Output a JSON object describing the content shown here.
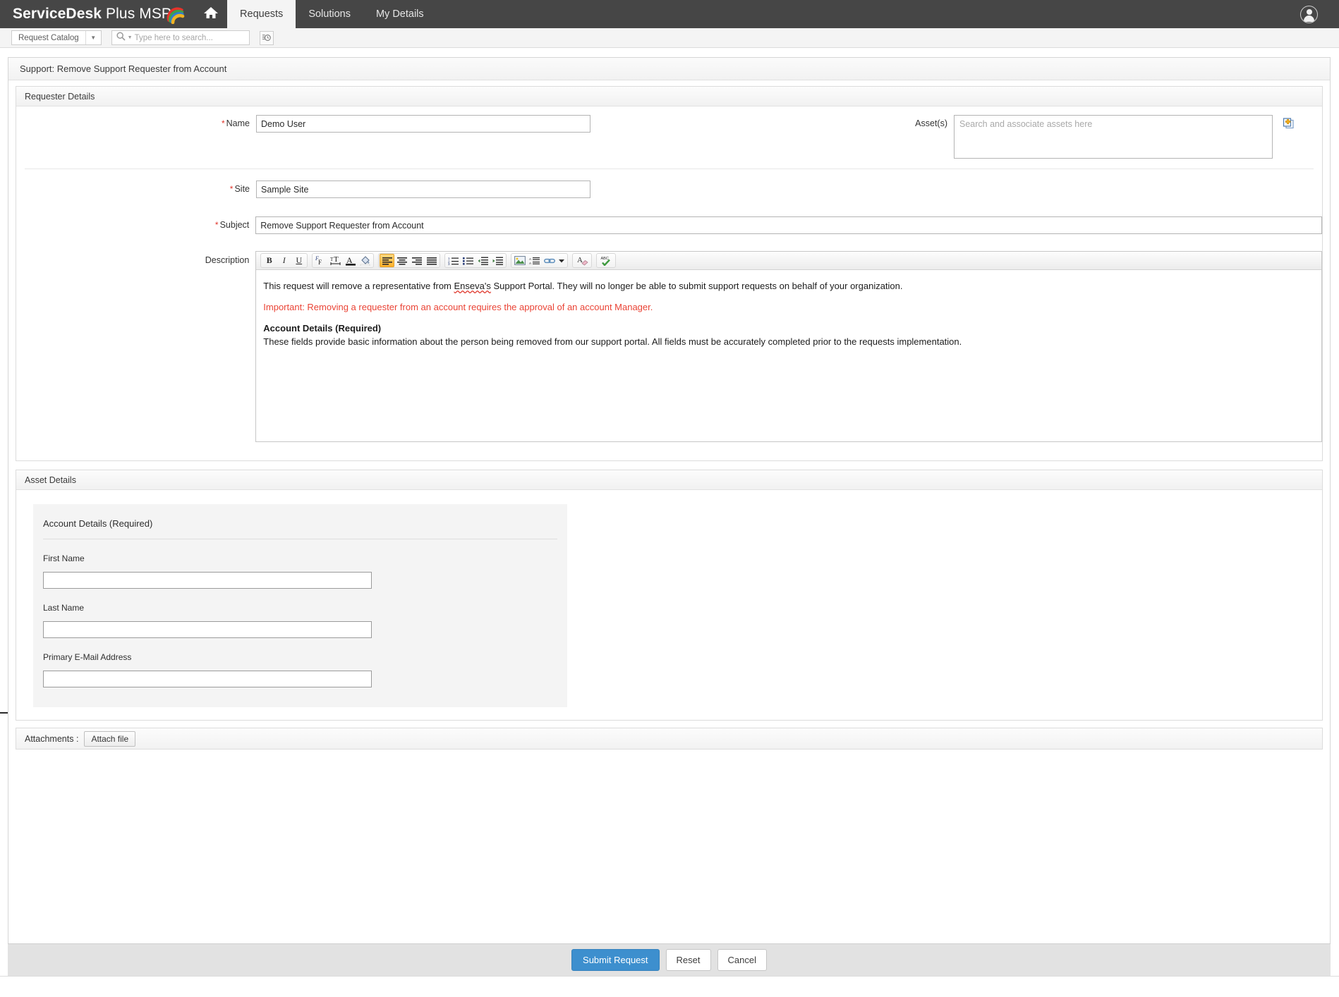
{
  "header": {
    "brand_bold": "ServiceDesk",
    "brand_rest": "Plus MSP",
    "home_icon": "home-icon",
    "tabs": [
      {
        "label": "Requests",
        "active": true
      },
      {
        "label": "Solutions",
        "active": false
      },
      {
        "label": "My Details",
        "active": false
      }
    ],
    "user_icon": "user-avatar-icon"
  },
  "searchbar": {
    "catalog_label": "Request Catalog",
    "catalog_caret_icon": "chevron-down-icon",
    "search_icon": "search-icon",
    "search_caret_icon": "chevron-down-icon",
    "search_placeholder": "Type here to search...",
    "search_value": "",
    "history_icon": "search-history-icon"
  },
  "page": {
    "title": "Support: Remove Support Requester from Account"
  },
  "requester_section": {
    "heading": "Requester Details",
    "name": {
      "label": "Name",
      "required": true,
      "value": "Demo User"
    },
    "assets": {
      "label": "Asset(s)",
      "placeholder": "Search and associate assets here",
      "value": "",
      "add_icon": "add-asset-icon"
    },
    "site": {
      "label": "Site",
      "required": true,
      "value": "Sample Site"
    },
    "subject": {
      "label": "Subject",
      "required": true,
      "value": "Remove Support Requester from Account"
    },
    "description": {
      "label": "Description",
      "toolbar": [
        {
          "name": "bold-icon",
          "glyph": "B",
          "active": false
        },
        {
          "name": "italic-icon",
          "glyph": "I",
          "active": false
        },
        {
          "name": "underline-icon",
          "glyph": "U",
          "active": false
        },
        {
          "name": "font-family-icon",
          "glyph": "F",
          "active": false
        },
        {
          "name": "font-size-icon",
          "glyph": "T",
          "active": false
        },
        {
          "name": "text-color-icon",
          "glyph": "A",
          "active": false
        },
        {
          "name": "background-color-icon",
          "glyph": "paint",
          "active": false
        },
        {
          "name": "align-left-icon",
          "glyph": "lines",
          "active": true
        },
        {
          "name": "align-center-icon",
          "glyph": "lines",
          "active": false
        },
        {
          "name": "align-right-icon",
          "glyph": "lines",
          "active": false
        },
        {
          "name": "align-justify-icon",
          "glyph": "lines",
          "active": false
        },
        {
          "name": "ordered-list-icon",
          "glyph": "list",
          "active": false
        },
        {
          "name": "unordered-list-icon",
          "glyph": "list",
          "active": false
        },
        {
          "name": "outdent-icon",
          "glyph": "indent",
          "active": false
        },
        {
          "name": "indent-icon",
          "glyph": "indent",
          "active": false
        },
        {
          "name": "insert-image-icon",
          "glyph": "image",
          "active": false
        },
        {
          "name": "insert-table-icon",
          "glyph": "table",
          "active": false
        },
        {
          "name": "insert-link-icon",
          "glyph": "link",
          "active": false
        },
        {
          "name": "more-options-caret-icon",
          "glyph": "caret",
          "active": false
        },
        {
          "name": "remove-format-icon",
          "glyph": "eraser",
          "active": false
        },
        {
          "name": "spellcheck-icon",
          "glyph": "abc",
          "active": false
        }
      ],
      "body": {
        "para1_before": "This request will remove a representative from ",
        "para1_misspelled": "Enseva's",
        "para1_after": " Support Portal. They will no longer be able to submit support requests on behalf of your organization.",
        "para2": "Important:  Removing a requester from an account requires the approval of an account Manager.",
        "para3_heading": "Account Details (Required)",
        "para3_text": "These fields provide basic information about the person being removed from our support portal.  All fields must be accurately completed prior to the requests implementation."
      }
    }
  },
  "asset_details_section": {
    "heading": "Asset Details",
    "subcard_title": "Account Details (Required)",
    "fields": [
      {
        "label": "First Name",
        "value": ""
      },
      {
        "label": "Last Name",
        "value": ""
      },
      {
        "label": "Primary E-Mail Address",
        "value": ""
      }
    ]
  },
  "attachments": {
    "label": "Attachments :",
    "button_label": "Attach file"
  },
  "footer": {
    "submit_label": "Submit Request",
    "reset_label": "Reset",
    "cancel_label": "Cancel"
  },
  "colors": {
    "topbar_bg": "#464646",
    "accent_blue": "#3d8fce",
    "required_star": "#e0352b",
    "important_red": "#ea4335",
    "active_tab_bg": "#f4f4f4"
  }
}
